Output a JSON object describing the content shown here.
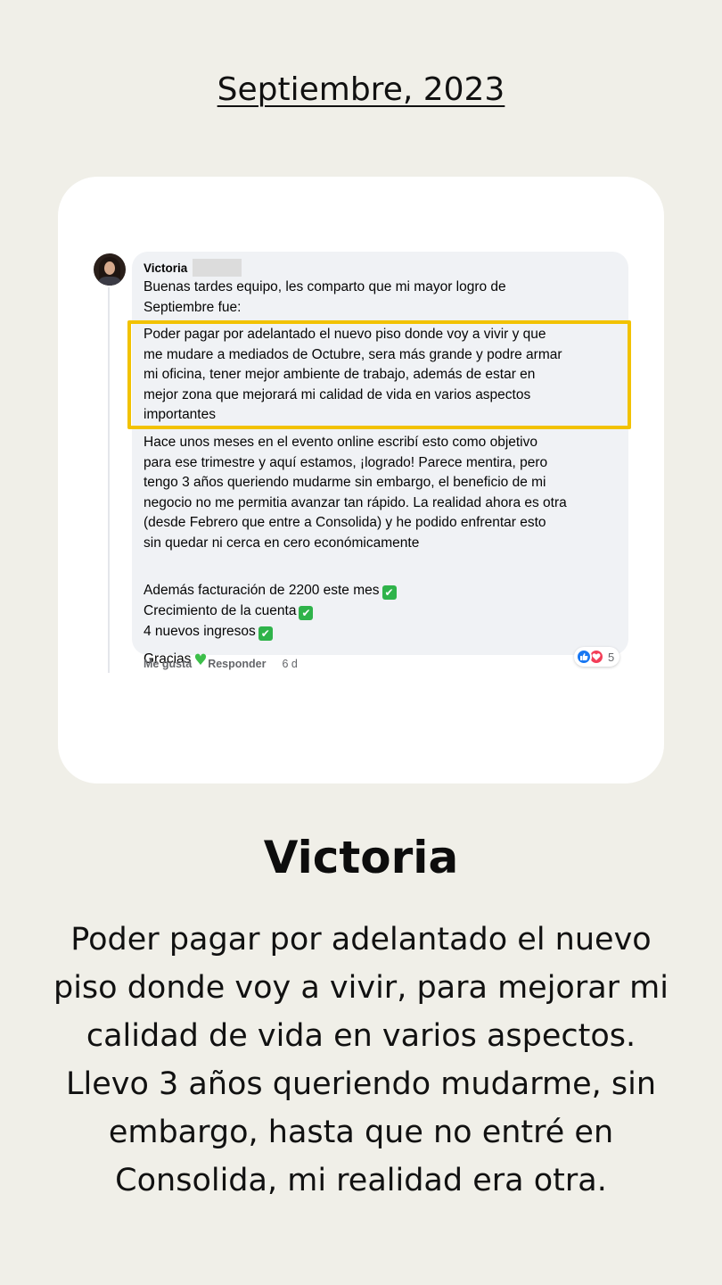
{
  "header": {
    "date": "Septiembre, 2023"
  },
  "comment": {
    "author": "Victoria",
    "intro": "Buenas tardes equipo, les comparto que mi mayor logro de\nSeptiembre fue:",
    "highlight": "Poder pagar por adelantado el nuevo piso donde voy a vivir y que\nme mudare a mediados de Octubre, sera más grande y podre armar\nmi oficina, tener mejor ambiente de trabajo, además de estar en\nmejor zona que mejorará mi calidad de vida en varios aspectos\nimportantes",
    "paragraph2": "Hace unos meses en el evento online escribí esto como objetivo\npara ese trimestre y aquí estamos, ¡logrado! Parece mentira, pero\ntengo 3 años queriendo mudarme sin embargo, el beneficio de mi\nnegocio no me permitia avanzar tan rápido. La realidad ahora es otra\n(desde Febrero que entre a Consolida) y he podido enfrentar esto\nsin quedar ni cerca en cero económicamente",
    "list": [
      "Además facturación de 2200 este mes",
      "Crecimiento de la cuenta",
      "4 nuevos ingresos"
    ],
    "closing": "Gracias",
    "actions": {
      "like": "Me gusta",
      "reply": "Responder",
      "time": "6 d"
    },
    "reactions": {
      "count": "5",
      "types": [
        "like-icon",
        "love-icon"
      ]
    }
  },
  "testimonial": {
    "name": "Victoria",
    "summary": "Poder pagar por adelantado el nuevo piso donde voy a vivir, para mejorar mi calidad de vida en varios aspectos. Llevo 3 años queriendo mudarme, sin embargo, hasta que no entré en Consolida, mi realidad era otra."
  },
  "colors": {
    "background": "#f0efe8",
    "card": "#ffffff",
    "bubble": "#f0f2f5",
    "highlight_border": "#f2c200",
    "check": "#2fb34a",
    "heart": "#3dbf4a",
    "like": "#1877f2",
    "love": "#f33e58"
  }
}
